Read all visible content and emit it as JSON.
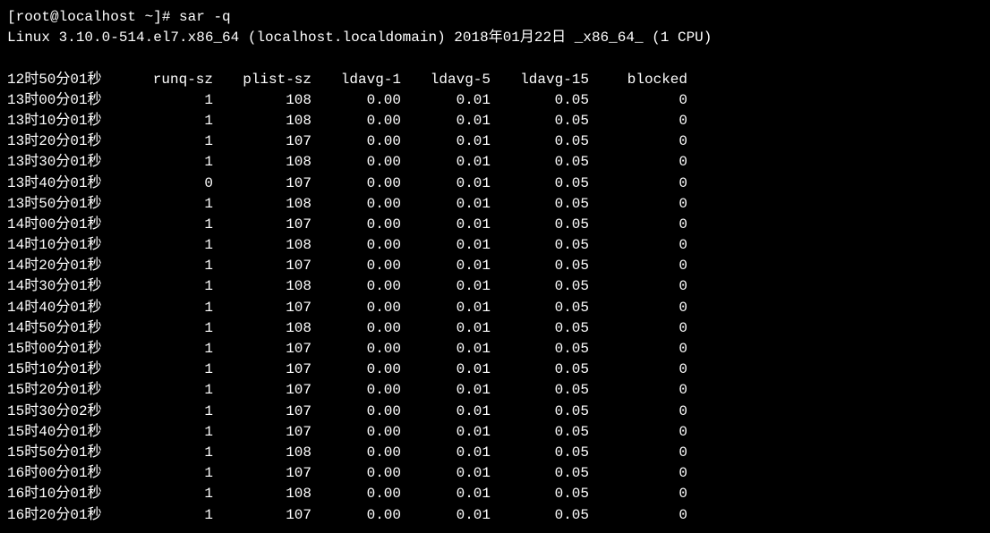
{
  "prompt": {
    "user_host": "[root@localhost ~]#",
    "command": "sar -q"
  },
  "sysline": {
    "kernel": "Linux 3.10.0-514.el7.x86_64 (localhost.localdomain)",
    "date": "2018年01月22日",
    "arch": "_x86_64_",
    "cpu": "(1 CPU)"
  },
  "headers": {
    "time": "12时50分01秒",
    "runq": "runq-sz",
    "plist": "plist-sz",
    "ld1": "ldavg-1",
    "ld5": "ldavg-5",
    "ld15": "ldavg-15",
    "blk": "blocked"
  },
  "rows": [
    {
      "time": "13时00分01秒",
      "runq": "1",
      "plist": "108",
      "ld1": "0.00",
      "ld5": "0.01",
      "ld15": "0.05",
      "blk": "0"
    },
    {
      "time": "13时10分01秒",
      "runq": "1",
      "plist": "108",
      "ld1": "0.00",
      "ld5": "0.01",
      "ld15": "0.05",
      "blk": "0"
    },
    {
      "time": "13时20分01秒",
      "runq": "1",
      "plist": "107",
      "ld1": "0.00",
      "ld5": "0.01",
      "ld15": "0.05",
      "blk": "0"
    },
    {
      "time": "13时30分01秒",
      "runq": "1",
      "plist": "108",
      "ld1": "0.00",
      "ld5": "0.01",
      "ld15": "0.05",
      "blk": "0"
    },
    {
      "time": "13时40分01秒",
      "runq": "0",
      "plist": "107",
      "ld1": "0.00",
      "ld5": "0.01",
      "ld15": "0.05",
      "blk": "0"
    },
    {
      "time": "13时50分01秒",
      "runq": "1",
      "plist": "108",
      "ld1": "0.00",
      "ld5": "0.01",
      "ld15": "0.05",
      "blk": "0"
    },
    {
      "time": "14时00分01秒",
      "runq": "1",
      "plist": "107",
      "ld1": "0.00",
      "ld5": "0.01",
      "ld15": "0.05",
      "blk": "0"
    },
    {
      "time": "14时10分01秒",
      "runq": "1",
      "plist": "108",
      "ld1": "0.00",
      "ld5": "0.01",
      "ld15": "0.05",
      "blk": "0"
    },
    {
      "time": "14时20分01秒",
      "runq": "1",
      "plist": "107",
      "ld1": "0.00",
      "ld5": "0.01",
      "ld15": "0.05",
      "blk": "0"
    },
    {
      "time": "14时30分01秒",
      "runq": "1",
      "plist": "108",
      "ld1": "0.00",
      "ld5": "0.01",
      "ld15": "0.05",
      "blk": "0"
    },
    {
      "time": "14时40分01秒",
      "runq": "1",
      "plist": "107",
      "ld1": "0.00",
      "ld5": "0.01",
      "ld15": "0.05",
      "blk": "0"
    },
    {
      "time": "14时50分01秒",
      "runq": "1",
      "plist": "108",
      "ld1": "0.00",
      "ld5": "0.01",
      "ld15": "0.05",
      "blk": "0"
    },
    {
      "time": "15时00分01秒",
      "runq": "1",
      "plist": "107",
      "ld1": "0.00",
      "ld5": "0.01",
      "ld15": "0.05",
      "blk": "0"
    },
    {
      "time": "15时10分01秒",
      "runq": "1",
      "plist": "107",
      "ld1": "0.00",
      "ld5": "0.01",
      "ld15": "0.05",
      "blk": "0"
    },
    {
      "time": "15时20分01秒",
      "runq": "1",
      "plist": "107",
      "ld1": "0.00",
      "ld5": "0.01",
      "ld15": "0.05",
      "blk": "0"
    },
    {
      "time": "15时30分02秒",
      "runq": "1",
      "plist": "107",
      "ld1": "0.00",
      "ld5": "0.01",
      "ld15": "0.05",
      "blk": "0"
    },
    {
      "time": "15时40分01秒",
      "runq": "1",
      "plist": "107",
      "ld1": "0.00",
      "ld5": "0.01",
      "ld15": "0.05",
      "blk": "0"
    },
    {
      "time": "15时50分01秒",
      "runq": "1",
      "plist": "108",
      "ld1": "0.00",
      "ld5": "0.01",
      "ld15": "0.05",
      "blk": "0"
    },
    {
      "time": "16时00分01秒",
      "runq": "1",
      "plist": "107",
      "ld1": "0.00",
      "ld5": "0.01",
      "ld15": "0.05",
      "blk": "0"
    },
    {
      "time": "16时10分01秒",
      "runq": "1",
      "plist": "108",
      "ld1": "0.00",
      "ld5": "0.01",
      "ld15": "0.05",
      "blk": "0"
    },
    {
      "time": "16时20分01秒",
      "runq": "1",
      "plist": "107",
      "ld1": "0.00",
      "ld5": "0.01",
      "ld15": "0.05",
      "blk": "0"
    }
  ]
}
